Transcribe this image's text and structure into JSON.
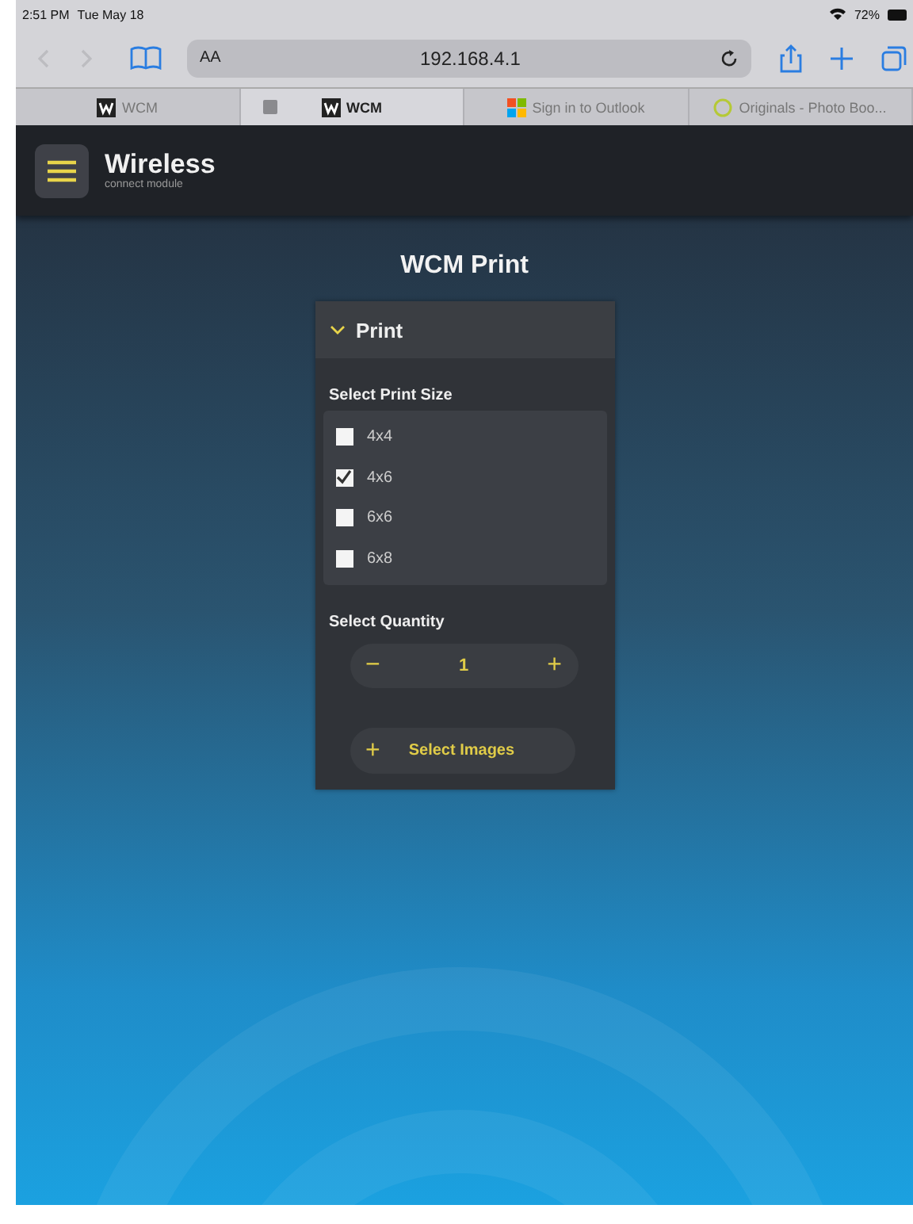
{
  "status_bar": {
    "time": "2:51 PM",
    "date": "Tue May 18",
    "battery": "72%"
  },
  "browser": {
    "reader_label": "AA",
    "url": "192.168.4.1"
  },
  "tabs": [
    {
      "label": "WCM",
      "kind": "w",
      "selected": false,
      "closable": false
    },
    {
      "label": "WCM",
      "kind": "w",
      "selected": true,
      "closable": true
    },
    {
      "label": "Sign in to Outlook",
      "kind": "grid",
      "selected": false,
      "closable": false
    },
    {
      "label": "Originals - Photo Boo...",
      "kind": "circle",
      "selected": false,
      "closable": false
    }
  ],
  "app_header": {
    "logo_title": "Wireless",
    "logo_subtitle": "connect module"
  },
  "page_title": "WCM Print",
  "panel": {
    "title": "Print",
    "expanded": true,
    "size_label": "Select Print Size",
    "sizes": [
      {
        "label": "4x4",
        "checked": false
      },
      {
        "label": "4x6",
        "checked": true
      },
      {
        "label": "6x6",
        "checked": false
      },
      {
        "label": "6x8",
        "checked": false
      }
    ],
    "quantity_label": "Select Quantity",
    "minus": "−",
    "quantity": "1",
    "plus": "+",
    "select_images": {
      "icon": "+",
      "label": "Select Images"
    }
  }
}
